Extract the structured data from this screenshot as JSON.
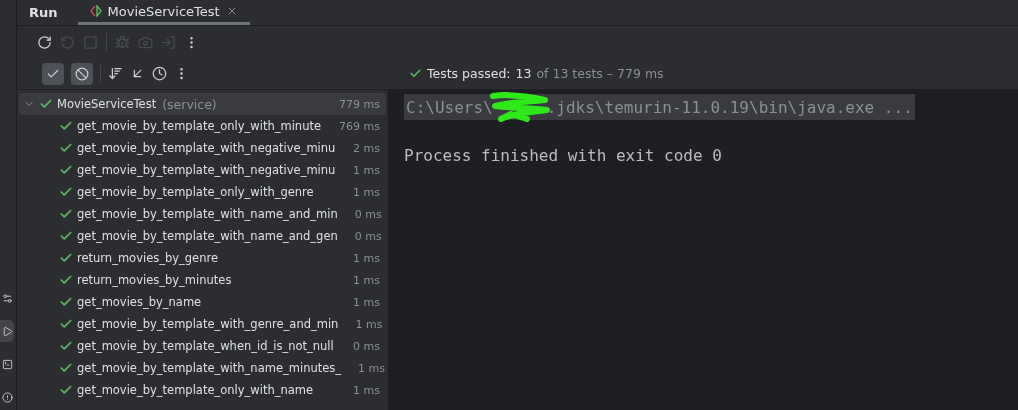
{
  "tool_window": {
    "title": "Run",
    "tabs": [
      {
        "label": "MovieServiceTest",
        "selected": true
      }
    ]
  },
  "left_strip": [
    {
      "kind": "services",
      "selected": false
    },
    {
      "kind": "run",
      "selected": true
    },
    {
      "kind": "terminal",
      "selected": false
    },
    {
      "kind": "problems",
      "selected": false
    }
  ],
  "toolbar": [
    {
      "kind": "rerun",
      "disabled": false
    },
    {
      "kind": "rerun-failed",
      "disabled": true
    },
    {
      "kind": "stop",
      "disabled": true
    },
    {
      "kind": "separator"
    },
    {
      "kind": "debug",
      "disabled": true
    },
    {
      "kind": "camera",
      "disabled": true
    },
    {
      "kind": "exit",
      "disabled": true
    },
    {
      "kind": "more",
      "disabled": false
    }
  ],
  "filters": [
    {
      "kind": "passed",
      "selected": true
    },
    {
      "kind": "ignored",
      "selected": true
    }
  ],
  "test_tools": [
    {
      "kind": "sort"
    },
    {
      "kind": "collapse"
    },
    {
      "kind": "history"
    },
    {
      "kind": "more"
    }
  ],
  "status": {
    "label": "Tests passed:",
    "count": "13",
    "rest": "of 13 tests – 779 ms"
  },
  "tree": {
    "name": "MovieServiceTest",
    "detail": "(service)",
    "time": "779 ms",
    "expanded": true,
    "selected": true,
    "children": [
      {
        "name": "get_movie_by_template_only_with_minute",
        "time": "769 ms"
      },
      {
        "name": "get_movie_by_template_with_negative_minu",
        "time": "2 ms"
      },
      {
        "name": "get_movie_by_template_with_negative_minu",
        "time": "1 ms"
      },
      {
        "name": "get_movie_by_template_only_with_genre",
        "time": "1 ms"
      },
      {
        "name": "get_movie_by_template_with_name_and_min",
        "time": "0 ms"
      },
      {
        "name": "get_movie_by_template_with_name_and_gen",
        "time": "0 ms"
      },
      {
        "name": "return_movies_by_genre",
        "time": "1 ms"
      },
      {
        "name": "return_movies_by_minutes",
        "time": "1 ms"
      },
      {
        "name": "get_movies_by_name",
        "time": "1 ms"
      },
      {
        "name": "get_movie_by_template_with_genre_and_min",
        "time": "1 ms"
      },
      {
        "name": "get_movie_by_template_when_id_is_not_null",
        "time": "0 ms"
      },
      {
        "name": "get_movie_by_template_with_name_minutes_",
        "time": "1 ms"
      },
      {
        "name": "get_movie_by_template_only_with_name",
        "time": "1 ms"
      }
    ]
  },
  "console": {
    "command_start": "C:\\Users\\",
    "command_end": ".jdks\\temurin-11.0.19\\bin\\java.exe ...",
    "lines": [
      "Process finished with exit code 0"
    ]
  }
}
